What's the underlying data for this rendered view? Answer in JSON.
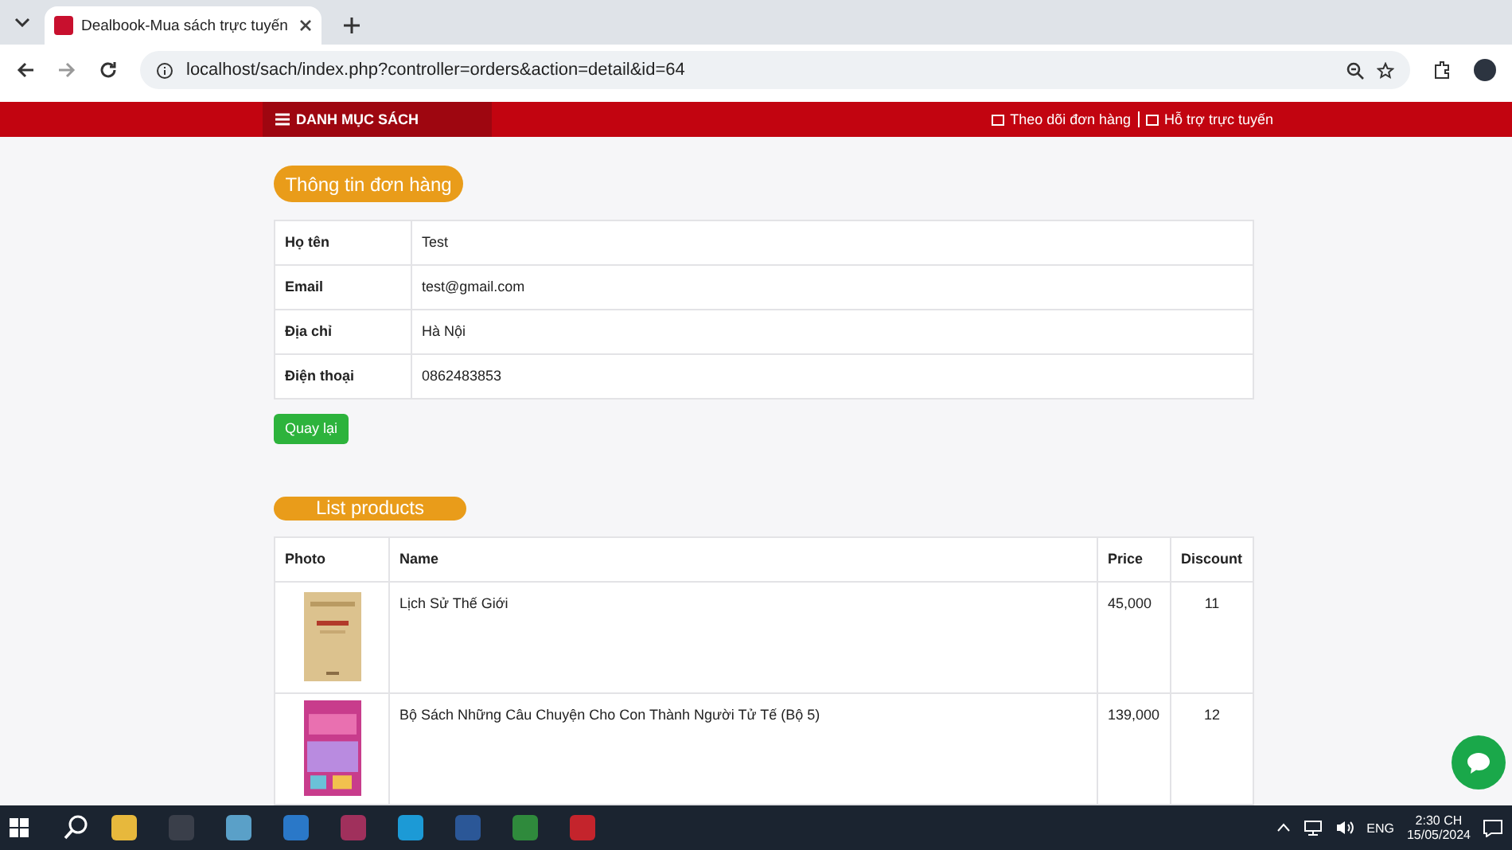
{
  "browser": {
    "tab": {
      "title": "Dealbook-Mua sách trực tuyến"
    },
    "url": "localhost/sach/index.php?controller=orders&action=detail&id=64"
  },
  "nav": {
    "menu": "DANH MỤC SÁCH",
    "links": [
      "Theo dõi đơn hàng",
      "Hỗ trợ trực tuyến"
    ]
  },
  "order_info": {
    "title": "Thông tin đơn hàng",
    "rows": [
      {
        "label": "Họ tên",
        "value": "Test"
      },
      {
        "label": "Email",
        "value": "test@gmail.com"
      },
      {
        "label": "Địa chỉ",
        "value": "Hà Nội"
      },
      {
        "label": "Điện thoại",
        "value": "0862483853"
      }
    ],
    "back_button": "Quay lại"
  },
  "products": {
    "title": "List products",
    "columns": [
      "Photo",
      "Name",
      "Price",
      "Discount"
    ],
    "rows": [
      {
        "name": "Lịch Sử Thế Giới",
        "price": "45,000",
        "discount": "11"
      },
      {
        "name": "Bộ Sách Những Câu Chuyện Cho Con Thành Người Tử Tế (Bộ 5)",
        "price": "139,000",
        "discount": "12"
      }
    ]
  },
  "taskbar": {
    "language": "ENG",
    "time": "2:30 CH",
    "date": "15/05/2024"
  }
}
